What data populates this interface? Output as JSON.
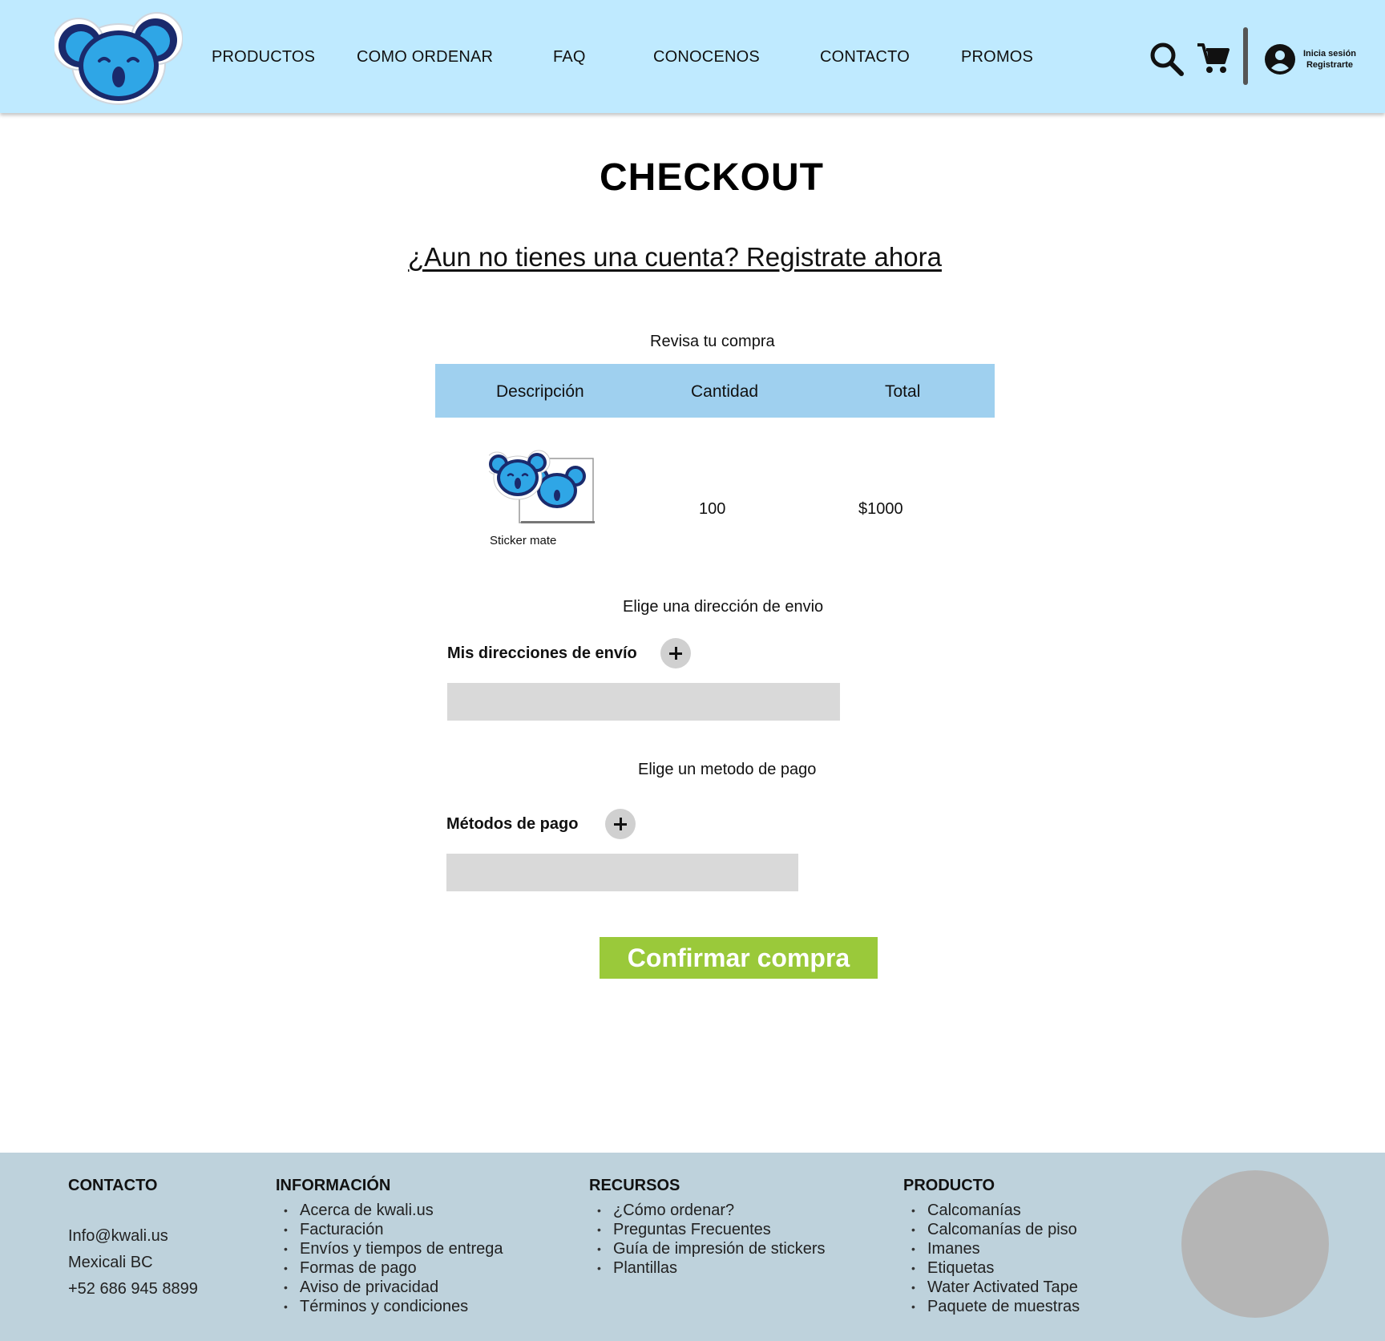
{
  "header": {
    "nav": [
      "PRODUCTOS",
      "COMO ORDENAR",
      "FAQ",
      "CONOCENOS",
      "CONTACTO",
      "PROMOS"
    ],
    "login_line1": "Inicia sesión",
    "login_line2": "Registrarte",
    "icons": [
      "koala-logo",
      "search-icon",
      "cart-icon",
      "user-icon"
    ]
  },
  "main": {
    "title": "CHECKOUT",
    "signup_link": "¿Aun no tienes una cuenta? Registrate ahora",
    "review_label": "Revisa tu compra",
    "table": {
      "columns": [
        "Descripción",
        "Cantidad",
        "Total"
      ],
      "rows": [
        {
          "name": "Sticker mate",
          "quantity": "100",
          "total": "$1000"
        }
      ]
    },
    "shipping_label": "Elige una dirección de envio",
    "addresses_label": "Mis direcciones de envío",
    "payment_label": "Elige un metodo de pago",
    "payment_methods_label": "Métodos de pago",
    "confirm_button": "Confirmar compra"
  },
  "footer": {
    "contact": {
      "heading": "CONTACTO",
      "email": "Info@kwali.us",
      "city": "Mexicali BC",
      "phone": "+52 686 945 8899"
    },
    "info": {
      "heading": "INFORMACIÓN",
      "items": [
        "Acerca de kwali.us",
        "Facturación",
        "Envíos y tiempos de entrega",
        "Formas de pago",
        "Aviso de privacidad",
        "Términos y condiciones"
      ]
    },
    "resources": {
      "heading": "RECURSOS",
      "items": [
        "¿Cómo ordenar?",
        "Preguntas Frecuentes",
        "Guía de impresión de stickers",
        "Plantillas"
      ]
    },
    "product": {
      "heading": "PRODUCTO",
      "items": [
        "Calcomanías",
        "Calcomanías de piso",
        "Imanes",
        "Etiquetas",
        "Water Activated Tape",
        "Paquete de muestras"
      ]
    }
  },
  "colors": {
    "header_bg": "#bfeaff",
    "table_header_bg": "#9fd0ef",
    "confirm_button_bg": "#9ac93a",
    "footer_bg": "#bed2dc",
    "koala_blue": "#2fa6e6",
    "koala_dark": "#1a2a6c"
  }
}
